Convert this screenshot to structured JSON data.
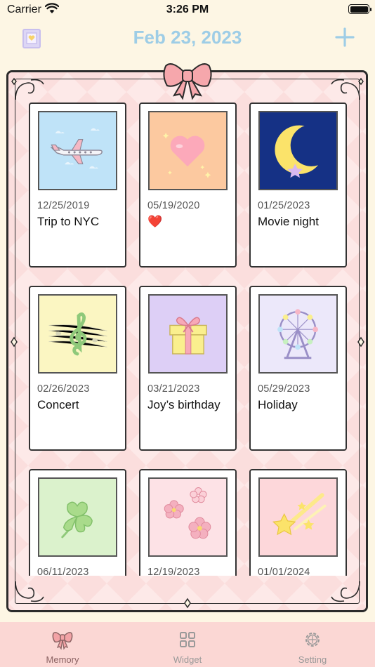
{
  "status_bar": {
    "carrier": "Carrier",
    "time": "3:26 PM"
  },
  "header": {
    "title": "Feb 23, 2023"
  },
  "memories": [
    {
      "date": "12/25/2019",
      "title": "Trip to NYC",
      "icon": "airplane-icon",
      "bg": "#bfe3f8"
    },
    {
      "date": "05/19/2020",
      "title": "❤️",
      "icon": "heart-icon",
      "bg": "#fcc9a0"
    },
    {
      "date": "01/25/2023",
      "title": "Movie night",
      "icon": "moon-icon",
      "bg": "#153185"
    },
    {
      "date": "02/26/2023",
      "title": "Concert",
      "icon": "treble-clef-icon",
      "bg": "#fbf6c2"
    },
    {
      "date": "03/21/2023",
      "title": "Joy’s birthday",
      "icon": "gift-icon",
      "bg": "#ddcff6"
    },
    {
      "date": "05/29/2023",
      "title": "Holiday",
      "icon": "ferris-wheel-icon",
      "bg": "#ece8fa"
    },
    {
      "date": "06/11/2023",
      "title": "",
      "icon": "clover-icon",
      "bg": "#dbf2cc"
    },
    {
      "date": "12/19/2023",
      "title": "",
      "icon": "cherry-blossom-icon",
      "bg": "#fde2e6"
    },
    {
      "date": "01/01/2024",
      "title": "",
      "icon": "shooting-star-icon",
      "bg": "#fdd7da"
    }
  ],
  "tabs": [
    {
      "label": "Memory",
      "icon": "ribbon-bow-icon",
      "active": true
    },
    {
      "label": "Widget",
      "icon": "widget-grid-icon",
      "active": false
    },
    {
      "label": "Setting",
      "icon": "gear-icon",
      "active": false
    }
  ],
  "colors": {
    "accent": "#9ecde6",
    "frame_pink": "#fbdedd",
    "tab_bar": "#fbd7d4",
    "background": "#fdf6e4"
  }
}
